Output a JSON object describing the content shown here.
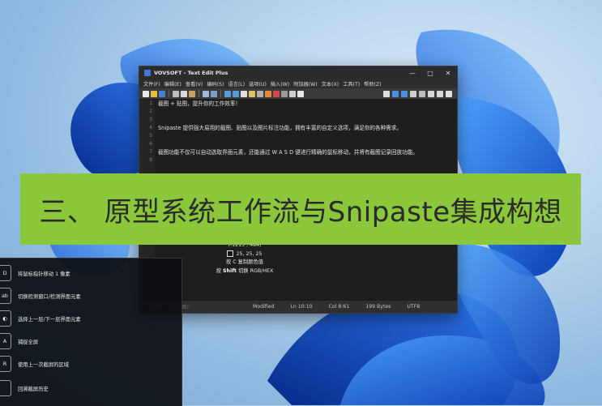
{
  "editor": {
    "title": "VOVSOFT - Text Edit Plus",
    "menu": [
      "文件(F)",
      "编辑(E)",
      "查看(V)",
      "编码(S)",
      "语言(L)",
      "选项(U)",
      "插入(W)",
      "附加器(W)",
      "文本(X)",
      "工具(T)",
      "帮助(Z)"
    ],
    "line_numbers": [
      "1",
      "2",
      "3",
      "4",
      "5",
      "6",
      "7",
      "8"
    ],
    "lines": {
      "l1": "截图 + 贴图，提升你的工作效率！",
      "l4": "Snipaste 提供强大易用的截图、贴图以及图片标注功能，拥有丰富的自定义选项，满足你的各种需求。",
      "l7": "截图功能不仅可以自动选取界面元素，还能通过 W A S D 键进行精确的鼠标移动，并将有截图记录回放功能。"
    },
    "status": {
      "ghost": "(文本)  ...(无)面图)",
      "mode": "Modified",
      "line": "Ln 10:10",
      "col": "Col 8:61",
      "size": "199 Bytes",
      "encoding": "UTF8"
    }
  },
  "magnifier": {
    "coords": "(-1215 , 484)",
    "rgb": "25,  25,  25",
    "hint_copy": "按 C 复制颜色值",
    "hint_key_c": "C",
    "hint_switch_pre": "按",
    "hint_switch_key": "Shift",
    "hint_switch_post": "切换 RGB/HEX"
  },
  "shortcuts": [
    {
      "key": "D",
      "label": "将鼠标指针移动 1 像素"
    },
    {
      "key": "ab",
      "label": "切换检测窗口/检测界面元素"
    },
    {
      "key": "◐",
      "label": "选择上一层/下一层界面元素"
    },
    {
      "key": "A",
      "label": "捕捉全屏"
    },
    {
      "key": "R",
      "label": "使用上一次截屏的区域"
    },
    {
      "key": "",
      "label": "回溯截屏历史"
    }
  ],
  "banner": {
    "text": "三、 原型系统工作流与Snipaste集成构想"
  },
  "colors": {
    "banner_bg": "#8ac73b",
    "editor_bg": "#1e1e1e",
    "wallpaper_blue": "#1a5fd8"
  }
}
